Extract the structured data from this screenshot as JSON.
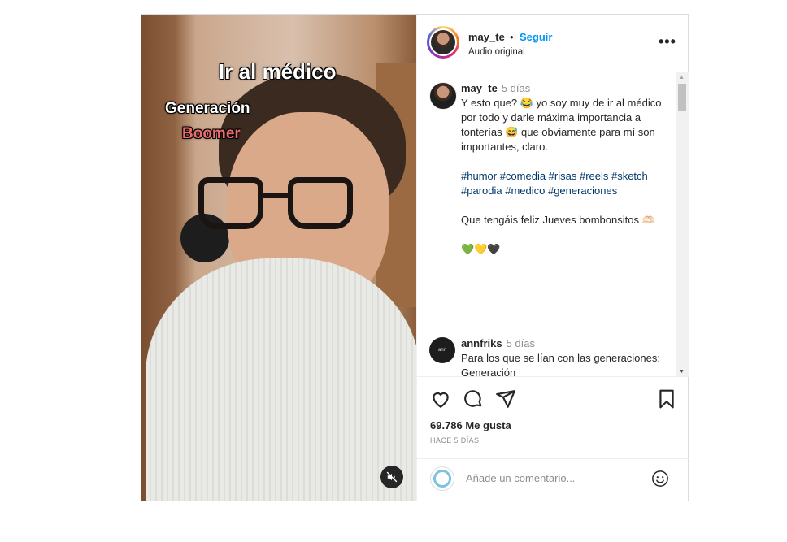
{
  "media": {
    "overlay_line1": "Ir al médico",
    "overlay_line2": "Generación",
    "overlay_line3": "Boomer",
    "mute_icon": "muted-speaker-icon"
  },
  "header": {
    "username": "may_te",
    "separator": "•",
    "follow_label": "Seguir",
    "subtitle": "Audio original",
    "more_label": "•••"
  },
  "comments": [
    {
      "user": "may_te",
      "time": "5 días",
      "text_1": "Y esto que? 😂 yo soy muy de ir al médico por todo y darle máxima importancia a tonterías 😅 que obviamente para mí son importantes, claro.",
      "hashtags": "#humor #comedia #risas #reels #sketch #parodia #medico #generaciones",
      "text_2": "Que tengáis feliz Jueves bombonsitos 🫶🏻",
      "hearts": "💚💛🖤"
    },
    {
      "user": "annfriks",
      "time": "5 días",
      "text_1": "Para los que se lían con las generaciones: Generación"
    }
  ],
  "actions": {
    "likes": "69.786 Me gusta",
    "ago": "HACE 5 DÍAS"
  },
  "add_comment": {
    "placeholder": "Añade un comentario..."
  },
  "colors": {
    "accent": "#0095f6",
    "text": "#262626",
    "muted": "#8e8e8e",
    "hashtag": "#00376b",
    "overlay_red": "#f06b6b"
  }
}
